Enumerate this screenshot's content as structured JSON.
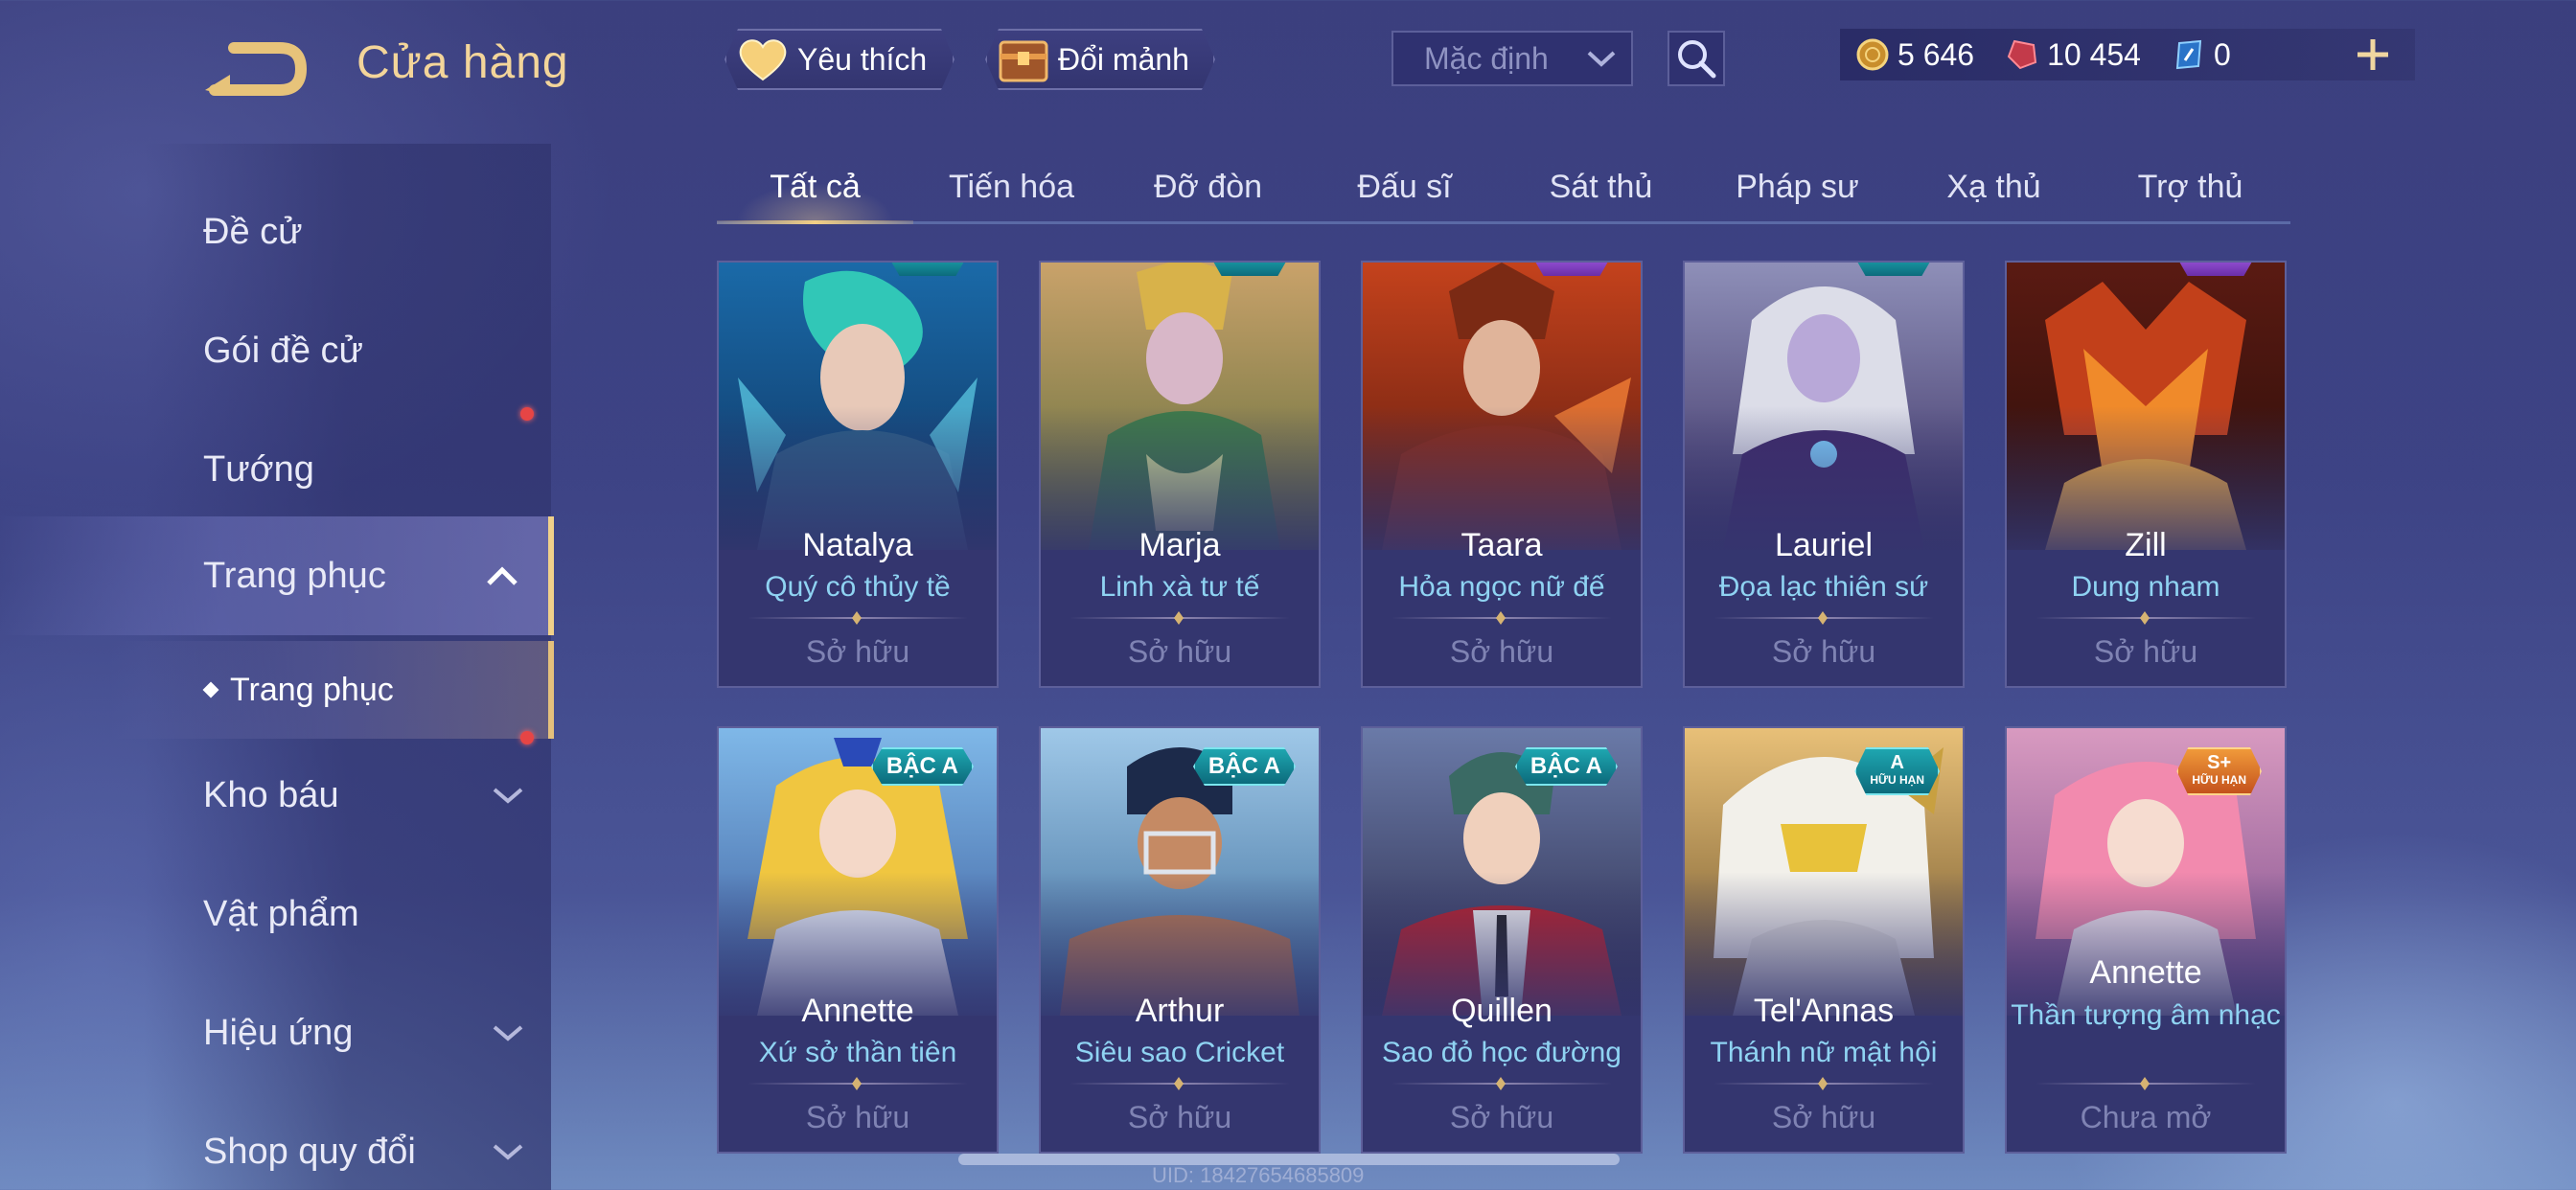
{
  "header": {
    "title": "Cửa hàng",
    "favorite_label": "Yêu thích",
    "shard_label": "Đổi mảnh",
    "sort_value": "Mặc định",
    "currencies": [
      {
        "name": "gold",
        "value": "5 646",
        "color": "#e8b64c"
      },
      {
        "name": "voucher",
        "value": "10 454",
        "color": "#d0455a"
      },
      {
        "name": "crystal",
        "value": "0",
        "color": "#6fb6ff"
      }
    ]
  },
  "sidebar": {
    "items": [
      {
        "label": "Đề cử"
      },
      {
        "label": "Gói đề cử",
        "dot": true
      },
      {
        "label": "Tướng"
      },
      {
        "label": "Trang phục",
        "expanded": true
      },
      {
        "label": "Trang phục",
        "sub": true
      },
      {
        "label": "Kho báu",
        "dot": true
      },
      {
        "label": "Vật phẩm"
      },
      {
        "label": "Hiệu ứng"
      },
      {
        "label": "Shop quy đổi"
      }
    ]
  },
  "tabs": [
    "Tất cả",
    "Tiến hóa",
    "Đỡ đòn",
    "Đấu sĩ",
    "Sát thủ",
    "Pháp sư",
    "Xạ thủ",
    "Trợ thủ"
  ],
  "cards": [
    {
      "hero": "Natalya",
      "skin": "Quý cô thủy tề",
      "status": "Sở hữu"
    },
    {
      "hero": "Marja",
      "skin": "Linh xà tư tế",
      "status": "Sở hữu"
    },
    {
      "hero": "Taara",
      "skin": "Hỏa ngọc nữ đế",
      "status": "Sở hữu"
    },
    {
      "hero": "Lauriel",
      "skin": "Đọa lạc thiên sứ",
      "status": "Sở hữu"
    },
    {
      "hero": "Zill",
      "skin": "Dung nham",
      "status": "Sở hữu"
    },
    {
      "hero": "Annette",
      "skin": "Xứ sở thần tiên",
      "status": "Sở hữu",
      "badge": "BẬC A"
    },
    {
      "hero": "Arthur",
      "skin": "Siêu sao Cricket",
      "status": "Sở hữu",
      "badge": "BẬC A"
    },
    {
      "hero": "Quillen",
      "skin": "Sao đỏ học đường",
      "status": "Sở hữu",
      "badge": "BẬC A"
    },
    {
      "hero": "Tel'Annas",
      "skin": "Thánh nữ mật hội",
      "status": "Sở hữu",
      "badge": "A",
      "badge_sub": "HỮU HẠN"
    },
    {
      "hero": "Annette",
      "skin": "Thần tượng âm nhạc",
      "status": "Chưa mở",
      "badge": "S+",
      "badge_sub": "HỮU HẠN"
    }
  ],
  "footer": {
    "uid": "UID: 18427654685809"
  }
}
